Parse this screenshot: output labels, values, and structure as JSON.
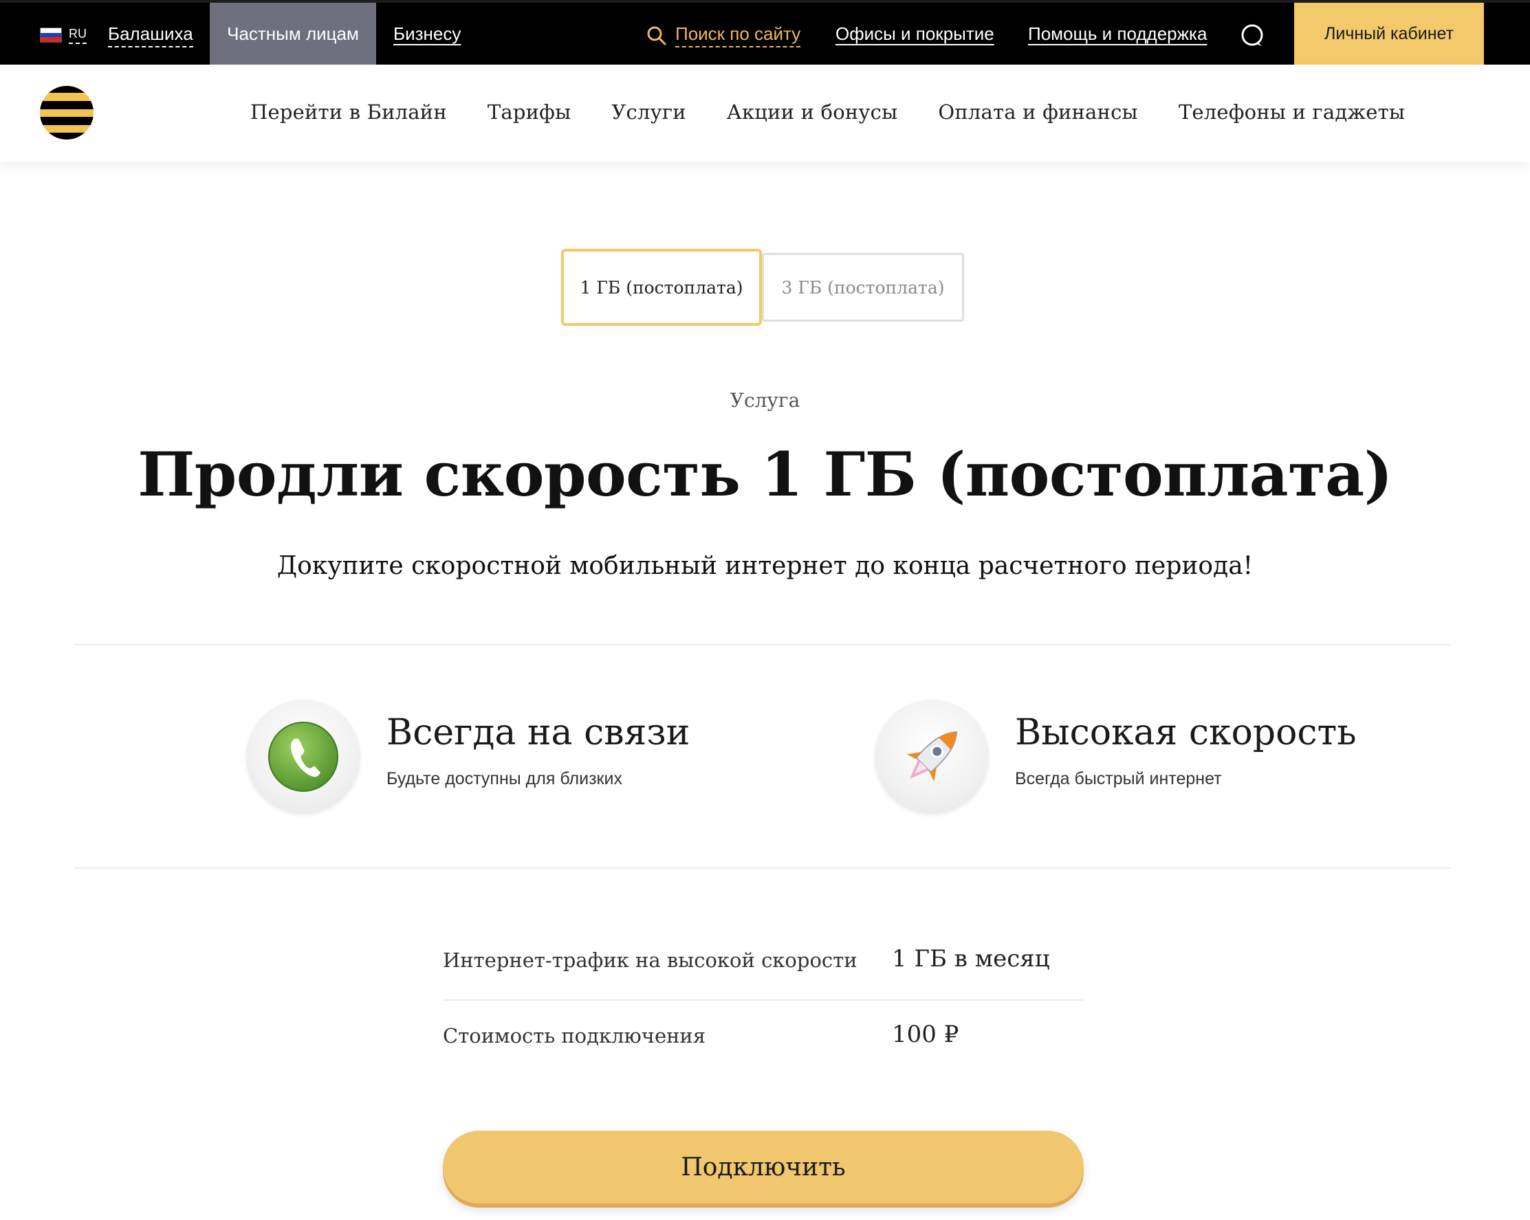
{
  "topbar": {
    "lang_code": "RU",
    "city": "Балашиха",
    "segments": {
      "private": "Частным лицам",
      "business": "Бизнесу"
    },
    "search_label": "Поиск по сайту",
    "offices_label": "Офисы и покрытие",
    "help_label": "Помощь и поддержка",
    "cabinet_label": "Личный кабинет"
  },
  "nav": {
    "items": [
      {
        "label": "Перейти в Билайн"
      },
      {
        "label": "Тарифы"
      },
      {
        "label": "Услуги"
      },
      {
        "label": "Акции и бонусы"
      },
      {
        "label": "Оплата и финансы"
      },
      {
        "label": "Телефоны и гаджеты"
      }
    ]
  },
  "tabs": [
    {
      "label": "1 ГБ (постоплата)",
      "active": true
    },
    {
      "label": "3 ГБ (постоплата)",
      "active": false
    }
  ],
  "hero": {
    "kicker": "Услуга",
    "title": "Продли скорость 1 ГБ (постоплата)",
    "subtitle": "Докупите скоростной мобильный интернет до конца расчетного периода!"
  },
  "features": [
    {
      "title": "Всегда на связи",
      "subtitle": "Будьте доступны для близких",
      "icon": "phone-icon"
    },
    {
      "title": "Высокая скорость",
      "subtitle": "Всегда быстрый интернет",
      "icon": "rocket-icon"
    }
  ],
  "params": [
    {
      "label": "Интернет-трафик на высокой скорости",
      "value": "1 ГБ в месяц"
    },
    {
      "label": "Стоимость подключения",
      "value": "100 ₽"
    }
  ],
  "cta": {
    "label": "Подключить"
  },
  "colors": {
    "accent": "#f3c96b",
    "search_accent": "#f0b95b",
    "topbar_bg": "#000000",
    "active_segment_bg": "#6e7080"
  }
}
